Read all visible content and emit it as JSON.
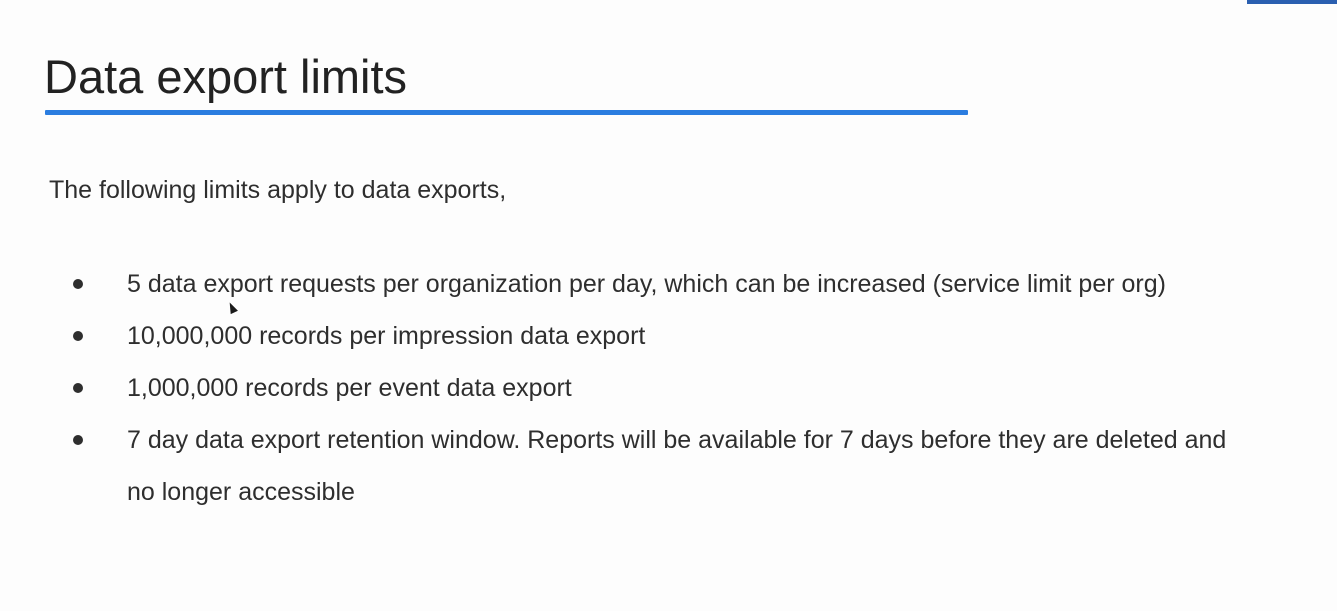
{
  "slide": {
    "title": "Data export limits",
    "intro": "The following limits apply to data exports,",
    "bullets": [
      "5 data export requests per organization per day, which can be increased (service limit per org)",
      "10,000,000 records per impression data export",
      "1,000,000 records per event data export",
      "7 day data export retention window. Reports will be available for 7 days before they are deleted and no longer accessible"
    ]
  },
  "colors": {
    "accent": "#2b7de0",
    "text": "#2e2e2e",
    "corner_accent": "#2a5fb0"
  },
  "icons": {
    "bullet": "bullet-dot-icon",
    "pointer": "mouse-pointer-icon"
  }
}
